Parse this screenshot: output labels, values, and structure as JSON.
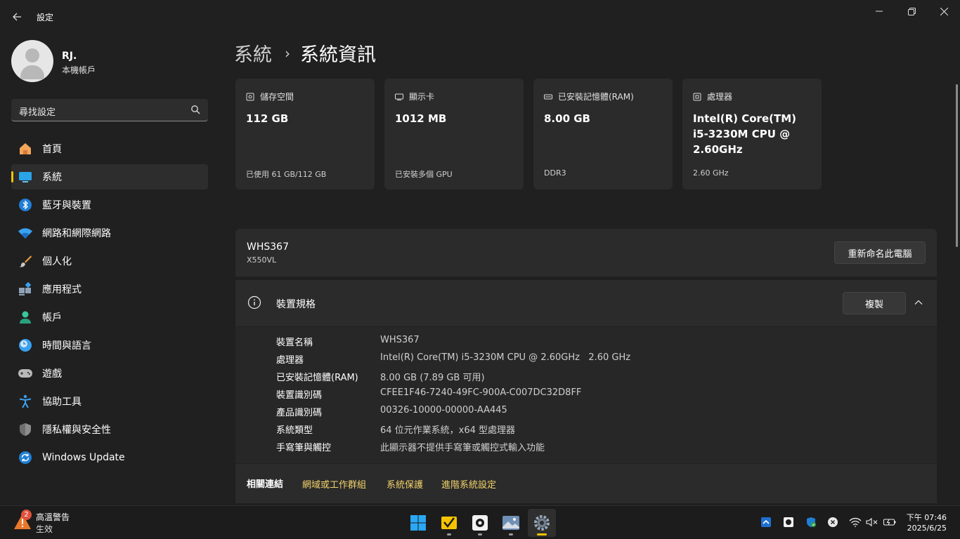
{
  "window": {
    "title": "設定",
    "back_icon": "arrow-left-icon",
    "minimize_icon": "minimize-icon",
    "restore_icon": "restore-icon",
    "close_icon": "close-icon"
  },
  "sidebar": {
    "user": {
      "name": "RJ.",
      "account_type": "本機帳戶"
    },
    "search": {
      "text": "尋找設定"
    },
    "items": [
      {
        "label": "首頁",
        "icon": "home-icon",
        "active": false
      },
      {
        "label": "系統",
        "icon": "system-icon",
        "active": true
      },
      {
        "label": "藍牙與裝置",
        "icon": "bluetooth-icon",
        "active": false
      },
      {
        "label": "網路和網際網路",
        "icon": "wifi-icon",
        "active": false
      },
      {
        "label": "個人化",
        "icon": "brush-icon",
        "active": false
      },
      {
        "label": "應用程式",
        "icon": "apps-icon",
        "active": false
      },
      {
        "label": "帳戶",
        "icon": "accounts-icon",
        "active": false
      },
      {
        "label": "時間與語言",
        "icon": "time-language-icon",
        "active": false
      },
      {
        "label": "遊戲",
        "icon": "gamepad-icon",
        "active": false
      },
      {
        "label": "協助工具",
        "icon": "accessibility-icon",
        "active": false
      },
      {
        "label": "隱私權與安全性",
        "icon": "shield-icon",
        "active": false
      },
      {
        "label": "Windows Update",
        "icon": "update-icon",
        "active": false
      }
    ]
  },
  "breadcrumb": {
    "parent": "系統",
    "separator": "›",
    "current": "系統資訊"
  },
  "cards": [
    {
      "label": "儲存空間",
      "icon": "storage-icon",
      "value": "112 GB",
      "sub": "已使用 61 GB/112 GB"
    },
    {
      "label": "顯示卡",
      "icon": "gpu-icon",
      "value": "1012 MB",
      "sub": "已安裝多個 GPU"
    },
    {
      "label": "已安裝記憶體(RAM)",
      "icon": "ram-icon",
      "value": "8.00 GB",
      "sub": "DDR3"
    },
    {
      "label": "處理器",
      "icon": "cpu-icon",
      "value": "Intel(R) Core(TM) i5-3230M CPU @ 2.60GHz",
      "sub": "2.60 GHz"
    }
  ],
  "device": {
    "name": "WHS367",
    "model": "X550VL",
    "rename_button": "重新命名此電腦"
  },
  "specs": {
    "title": "裝置規格",
    "copy_button": "複製",
    "rows": [
      {
        "key": "裝置名稱",
        "value": "WHS367"
      },
      {
        "key": "處理器",
        "value": "Intel(R) Core(TM) i5-3230M CPU @ 2.60GHz   2.60 GHz"
      },
      {
        "key": "已安裝記憶體(RAM)",
        "value": "8.00 GB (7.89 GB 可用)"
      },
      {
        "key": "裝置識別碼",
        "value": "CFEE1F46-7240-49FC-900A-C007DC32D8FF"
      },
      {
        "key": "產品識別碼",
        "value": "00326-10000-00000-AA445"
      },
      {
        "key": "系統類型",
        "value": "64 位元作業系統，x64 型處理器"
      },
      {
        "key": "手寫筆與觸控",
        "value": "此顯示器不提供手寫筆或觸控式輸入功能"
      }
    ]
  },
  "related": {
    "label": "相關連結",
    "links": [
      "網域或工作群組",
      "系統保護",
      "進階系統設定"
    ]
  },
  "taskbar": {
    "weather": {
      "badge": "2",
      "title": "高溫警告",
      "subtitle": "生效"
    },
    "apps": [
      "start-icon",
      "file-explorer-icon",
      "app-icon",
      "photos-icon",
      "settings-icon"
    ],
    "tray": [
      "tray-app-icon",
      "obs-icon",
      "defender-icon",
      "x-icon",
      "wifi-icon",
      "volume-muted-icon",
      "battery-icon"
    ],
    "time": "下午 07:46",
    "date": "2025/6/25"
  },
  "colors": {
    "accent": "#f0c400",
    "link": "#f3d36b",
    "background": "#202020",
    "card": "#2b2b2b"
  }
}
